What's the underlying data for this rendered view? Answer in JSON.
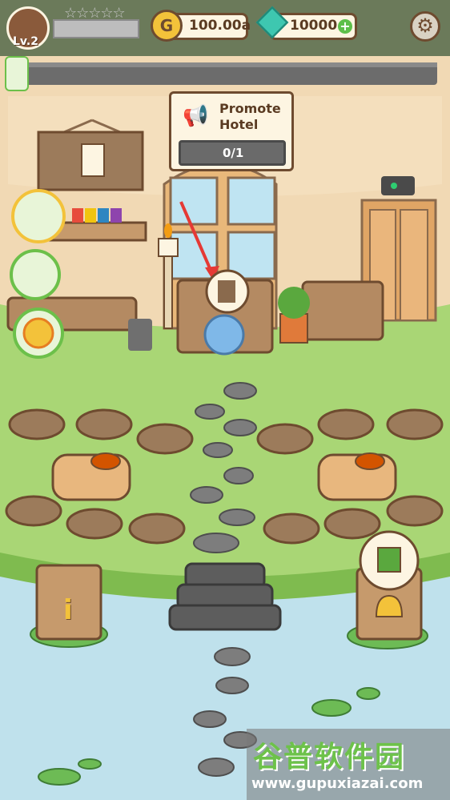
{
  "player": {
    "level": "Lv.2",
    "stars_filled": 0,
    "stars_total": 5
  },
  "currency": {
    "gold": "100.00a",
    "gems": "10000"
  },
  "icons": {
    "settings": "gear-icon",
    "add_gems": "plus-icon",
    "gold": "coin-icon",
    "gems": "diamond-icon",
    "notice": "document-icon",
    "promo": "megaphone-icon",
    "info": "info-icon",
    "bell": "bell-icon"
  },
  "task": {
    "title": "Promote\nHotel",
    "progress": "0/1"
  },
  "info_sign": "i",
  "watermark": {
    "brand": "谷普软件园",
    "url": "www.gupuxiazai.com"
  },
  "colors": {
    "accent": "#5dbf4a",
    "gem": "#3ec7b0",
    "gold": "#f3c23a",
    "wood": "#8a6a4d",
    "grass": "#a9d675",
    "water": "#bfe1ec"
  }
}
